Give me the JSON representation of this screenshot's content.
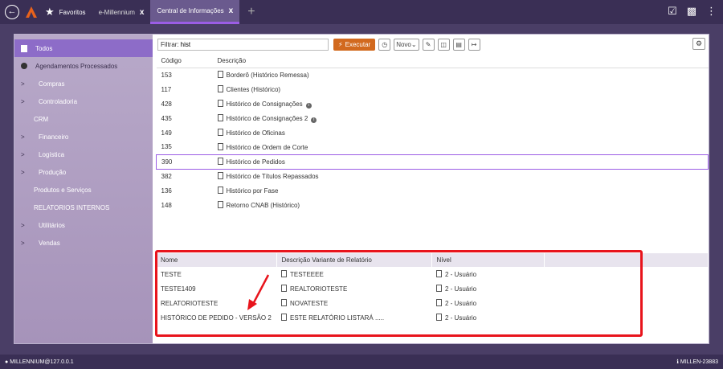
{
  "topbar": {
    "tabs": [
      {
        "label": "Favoritos"
      },
      {
        "label": "e-Millennium",
        "close": "x"
      },
      {
        "label": "Central de Informações",
        "close": "x"
      }
    ],
    "add_tab": "+"
  },
  "sidebar": {
    "items": [
      {
        "label": "Todos",
        "active": true
      },
      {
        "label": "Agendamentos Processados"
      },
      {
        "label": "Compras",
        "chevron": ">"
      },
      {
        "label": "Controladoria",
        "chevron": ">"
      },
      {
        "label": "CRM"
      },
      {
        "label": "Financeiro",
        "chevron": ">"
      },
      {
        "label": "Logística",
        "chevron": ">"
      },
      {
        "label": "Produção",
        "chevron": ">"
      },
      {
        "label": "Produtos e Serviços"
      },
      {
        "label": "RELATORIOS INTERNOS"
      },
      {
        "label": "Utilitários",
        "chevron": ">"
      },
      {
        "label": "Vendas",
        "chevron": ">"
      }
    ]
  },
  "filter": {
    "label": "Filtrar:",
    "value": "hist",
    "execute_label": "Executar",
    "new_label": "Novo"
  },
  "top_table": {
    "headers": [
      "Código",
      "Descrição"
    ],
    "rows": [
      {
        "code": "153",
        "desc": "Borderô (Histórico Remessa)"
      },
      {
        "code": "117",
        "desc": "Clientes (Histórico)"
      },
      {
        "code": "428",
        "desc": "Histórico de Consignações",
        "info": true
      },
      {
        "code": "435",
        "desc": "Histórico de Consignações 2",
        "info": true
      },
      {
        "code": "149",
        "desc": "Histórico de Oficinas"
      },
      {
        "code": "135",
        "desc": "Histórico de Ordem de Corte"
      },
      {
        "code": "390",
        "desc": "Histórico de Pedidos",
        "selected": true
      },
      {
        "code": "382",
        "desc": "Histórico de Títulos Repassados"
      },
      {
        "code": "136",
        "desc": "Histórico por Fase"
      },
      {
        "code": "148",
        "desc": "Retorno CNAB (Histórico)"
      }
    ]
  },
  "bottom_table": {
    "headers": [
      "Nome",
      "Descrição Variante de Relatório",
      "Nível"
    ],
    "rows": [
      {
        "name": "TESTE",
        "desc": "TESTEEEE",
        "level": "2 - Usuário"
      },
      {
        "name": "TESTE1409",
        "desc": "REALTORIOTESTE",
        "level": "2 - Usuário"
      },
      {
        "name": "RELATORIOTESTE",
        "desc": "NOVATESTE",
        "level": "2 - Usuário"
      },
      {
        "name": "HISTÓRICO DE PEDIDO - VERSÃO 2",
        "desc": "ESTE RELATÓRIO LISTARÁ .....",
        "level": "2 - Usuário"
      }
    ]
  },
  "footer": {
    "left": "MILLENNIUM@127.0.0.1",
    "right": "MILLEN-23883"
  },
  "colors": {
    "accent": "#9b5de5",
    "execute": "#d2691e",
    "highlight": "#e8141c"
  }
}
